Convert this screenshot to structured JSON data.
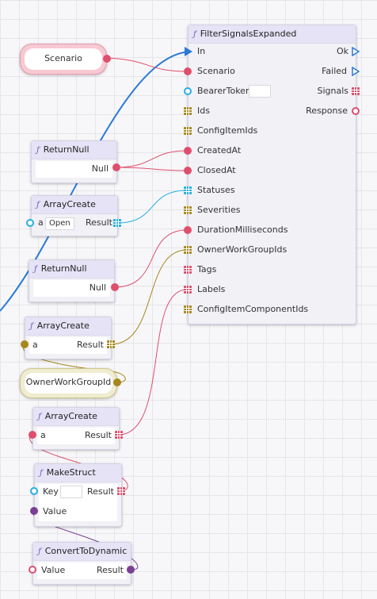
{
  "main_node": {
    "title": "FilterSignalsExpanded",
    "inputs": [
      {
        "label": "In"
      },
      {
        "label": "Scenario"
      },
      {
        "label": "BearerToken"
      },
      {
        "label": "Ids"
      },
      {
        "label": "ConfigItemIds"
      },
      {
        "label": "CreatedAt"
      },
      {
        "label": "ClosedAt"
      },
      {
        "label": "Statuses"
      },
      {
        "label": "Severities"
      },
      {
        "label": "DurationMilliseconds"
      },
      {
        "label": "OwnerWorkGroupIds"
      },
      {
        "label": "Tags"
      },
      {
        "label": "Labels"
      },
      {
        "label": "ConfigItemComponentIds"
      }
    ],
    "outputs": [
      {
        "label": "Ok"
      },
      {
        "label": "Failed"
      },
      {
        "label": "Signals"
      },
      {
        "label": "Response"
      }
    ]
  },
  "scenario_pill": {
    "label": "Scenario"
  },
  "owner_pill": {
    "label": "OwnerWorkGroupId"
  },
  "return_null_1": {
    "title": "ReturnNull",
    "output": "Null"
  },
  "array_create_1": {
    "title": "ArrayCreate",
    "input": "a",
    "input_value": "Open",
    "output": "Result"
  },
  "return_null_2": {
    "title": "ReturnNull",
    "output": "Null"
  },
  "array_create_2": {
    "title": "ArrayCreate",
    "input": "a",
    "output": "Result"
  },
  "array_create_3": {
    "title": "ArrayCreate",
    "input": "a",
    "output": "Result"
  },
  "make_struct": {
    "title": "MakeStruct",
    "input_key": "Key",
    "input_value": "Value",
    "output": "Result"
  },
  "convert_to_dynamic": {
    "title": "ConvertToDynamic",
    "input": "Value",
    "output": "Result"
  },
  "fx_symbol": "ƒ",
  "colors": {
    "string": "#de4f6d",
    "array_string_blue": "#26aee3",
    "guid": "#a7871d",
    "exec": "#2a79d6",
    "object": "#7a3f92"
  }
}
